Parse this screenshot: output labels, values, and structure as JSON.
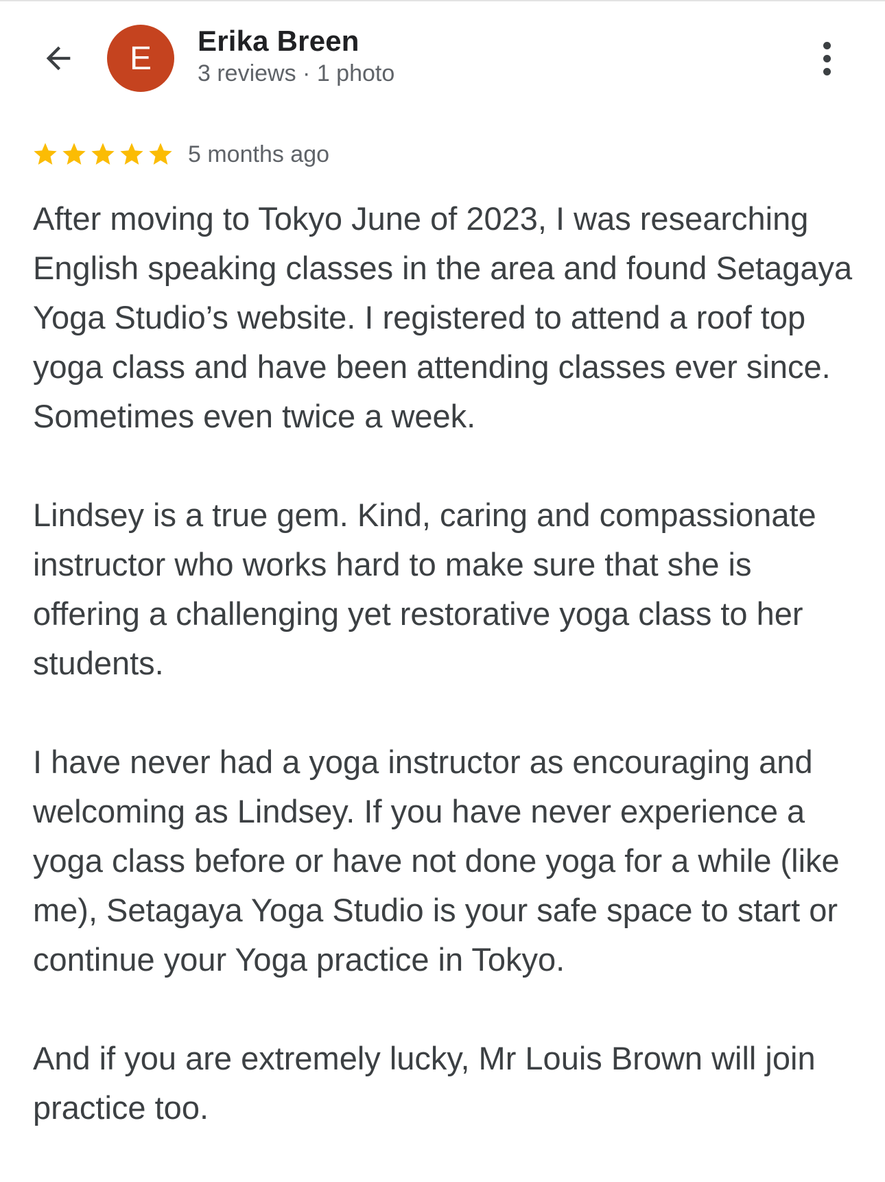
{
  "reviewer": {
    "name": "Erika Breen",
    "initial": "E",
    "meta": "3 reviews · 1 photo",
    "avatar_color": "#c5431f"
  },
  "icons": {
    "back": "arrow-back-icon",
    "more": "more-vert-icon",
    "star": "star-icon"
  },
  "review": {
    "rating": 5,
    "max_rating": 5,
    "star_color": "#fbbc04",
    "time": "5 months ago",
    "paragraphs": [
      "After moving to Tokyo June of 2023, I was researching English speaking classes in the area and found Setagaya Yoga Studio’s website. I registered to attend a roof top yoga class and have been attending classes ever since. Sometimes even twice a week.",
      "Lindsey is a true gem. Kind, caring and compassionate instructor who works hard to make sure that she is offering a challenging yet restorative yoga class to her students.",
      "I have never had a yoga instructor as encouraging and welcoming as Lindsey. If you have never experience a yoga class before or have not done yoga for a while (like me), Setagaya Yoga Studio is your safe space to start or continue your Yoga practice in Tokyo.",
      "And if you are extremely lucky, Mr Louis Brown will join practice too."
    ]
  }
}
